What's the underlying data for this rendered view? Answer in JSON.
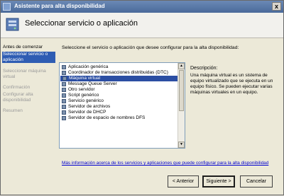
{
  "window": {
    "title": "Asistente para alta disponibilidad",
    "close_glyph": "x"
  },
  "header": {
    "title": "Seleccionar servicio o aplicación"
  },
  "nav": {
    "items": [
      {
        "label": "Antes de comenzar",
        "state": "done"
      },
      {
        "label": "Seleccionar servicio o aplicación",
        "state": "active"
      },
      {
        "label": "Seleccionar máquina virtual",
        "state": "pending"
      },
      {
        "label": "Confirmación",
        "state": "pending"
      },
      {
        "label": "Configurar alta disponibilidad",
        "state": "pending"
      },
      {
        "label": "Resumen",
        "state": "pending"
      }
    ]
  },
  "main": {
    "intro": "Seleccione el servicio o aplicación que desee configurar para la alta disponibilidad:",
    "services": [
      "Aplicación genérica",
      "Coordinador de transacciones distribuidas (DTC)",
      "Máquina virtual",
      "Message Queue Server",
      "Otro servidor",
      "Script genérico",
      "Servicio genérico",
      "Servidor de archivos",
      "Servidor de DHCP",
      "Servidor de espacio de nombres DFS"
    ],
    "selected_service": "Máquina virtual",
    "description_label": "Descripción:",
    "description_text": "Una máquina virtual es un sistema de equipo virtualizado que se ejecuta en un equipo físico. Se pueden ejecutar varias máquinas virtuales en un equipo.",
    "info_link": "Más información acerca de los servicios y aplicaciones que puede configurar para la alta disponibilidad"
  },
  "buttons": {
    "back": "< Anterior",
    "next": "Siguiente >",
    "cancel": "Cancelar"
  },
  "colors": {
    "selection": "#2b4ea3",
    "titlebar": "#5a78a8",
    "link": "#0000d0"
  }
}
